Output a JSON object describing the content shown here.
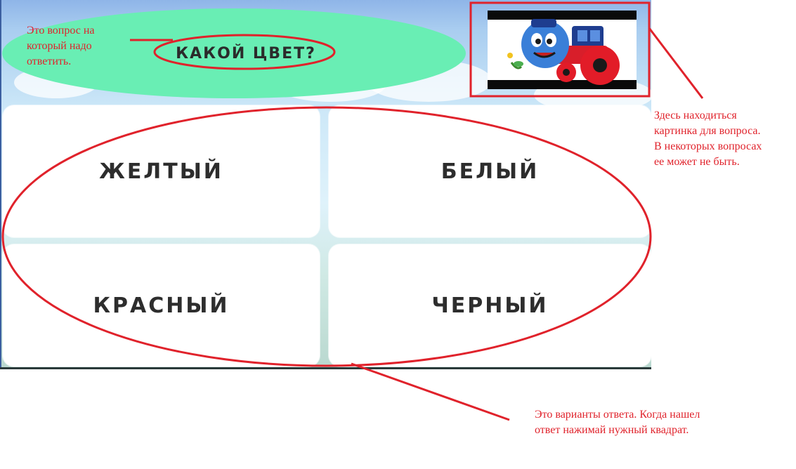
{
  "game": {
    "question": "КАКОЙ ЦВЕТ?",
    "picture_icon": "cartoon-train-icon",
    "answers": [
      "ЖЕЛТЫЙ",
      "БЕЛЫЙ",
      "КРАСНЫЙ",
      "ЧЕРНЫЙ"
    ]
  },
  "annotations": {
    "question_note": "Это вопрос на\nкоторый надо\nответить.",
    "picture_note": "Здесь находиться\nкартинка для вопроса.\nВ некоторых вопросах\nее может не быть.",
    "answers_note": "Это варианты ответа. Когда нашел\nответ нажимай нужный квадрат."
  },
  "colors": {
    "annotation_red": "#e0222b",
    "question_bubble": "#69eeb4",
    "answer_card": "#ffffff",
    "text_dark": "#2d2d2d"
  }
}
